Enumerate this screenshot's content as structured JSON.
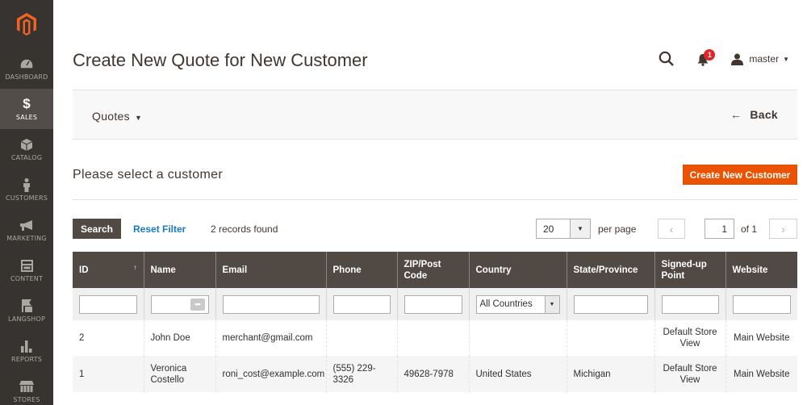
{
  "sidebar": {
    "logo": "magento-logo",
    "items": [
      {
        "label": "DASHBOARD",
        "icon": "dashboard-icon",
        "active": false
      },
      {
        "label": "SALES",
        "icon": "dollar-icon",
        "active": true
      },
      {
        "label": "CATALOG",
        "icon": "cube-icon",
        "active": false
      },
      {
        "label": "CUSTOMERS",
        "icon": "person-icon",
        "active": false
      },
      {
        "label": "MARKETING",
        "icon": "megaphone-icon",
        "active": false
      },
      {
        "label": "CONTENT",
        "icon": "content-icon",
        "active": false
      },
      {
        "label": "LANGSHOP",
        "icon": "langshop-icon",
        "active": false
      },
      {
        "label": "REPORTS",
        "icon": "bar-chart-icon",
        "active": false
      },
      {
        "label": "STORES",
        "icon": "store-icon",
        "active": false
      }
    ]
  },
  "header": {
    "title": "Create New Quote for New Customer",
    "notifications_count": "1",
    "user": "master"
  },
  "toolbar": {
    "quotes_label": "Quotes",
    "back_label": "Back"
  },
  "section": {
    "title": "Please select a customer",
    "create_button": "Create New Customer"
  },
  "grid_controls": {
    "search_button": "Search",
    "reset_filter": "Reset Filter",
    "records_found": "2 records found",
    "page_size": "20",
    "per_page": "per page",
    "current_page": "1",
    "of_pages": "of 1"
  },
  "table": {
    "columns": [
      "ID",
      "Name",
      "Email",
      "Phone",
      "ZIP/Post Code",
      "Country",
      "State/Province",
      "Signed-up Point",
      "Website"
    ],
    "country_filter": "All Countries",
    "rows": [
      {
        "id": "2",
        "name": "John Doe",
        "email": "merchant@gmail.com",
        "phone": "",
        "zip": "",
        "country": "",
        "state": "",
        "signed_up": "Default Store View",
        "website": "Main Website"
      },
      {
        "id": "1",
        "name": "Veronica Costello",
        "email": "roni_cost@example.com",
        "phone": "(555) 229-3326",
        "zip": "49628-7978",
        "country": "United States",
        "state": "Michigan",
        "signed_up": "Default Store View",
        "website": "Main Website"
      }
    ]
  },
  "colors": {
    "sidebar_bg": "#373330",
    "sidebar_active": "#524d49",
    "accent_orange": "#eb5202",
    "header_dark": "#514943",
    "link_blue": "#1979c3",
    "badge_red": "#e22626"
  }
}
